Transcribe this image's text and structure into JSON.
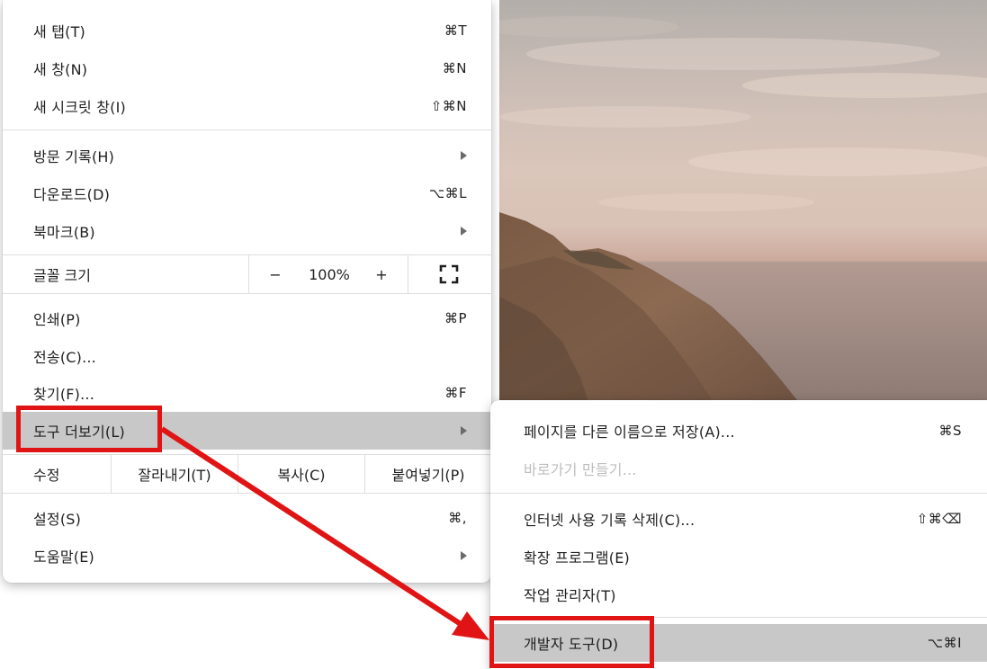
{
  "menu": {
    "new_tab": {
      "label": "새 탭(T)",
      "shortcut": "⌘T"
    },
    "new_window": {
      "label": "새 창(N)",
      "shortcut": "⌘N"
    },
    "new_incognito": {
      "label": "새 시크릿 창(I)",
      "shortcut": "⇧⌘N"
    },
    "history": {
      "label": "방문 기록(H)"
    },
    "downloads": {
      "label": "다운로드(D)",
      "shortcut": "⌥⌘L"
    },
    "bookmarks": {
      "label": "북마크(B)"
    },
    "zoom": {
      "label": "글꼴 크기",
      "minus": "−",
      "value": "100%",
      "plus": "+"
    },
    "print": {
      "label": "인쇄(P)",
      "shortcut": "⌘P"
    },
    "cast": {
      "label": "전송(C)..."
    },
    "find": {
      "label": "찾기(F)...",
      "shortcut": "⌘F"
    },
    "more_tools": {
      "label": "도구 더보기(L)"
    },
    "edit": {
      "label": "수정",
      "cut": "잘라내기(T)",
      "copy": "복사(C)",
      "paste": "붙여넣기(P)"
    },
    "settings": {
      "label": "설정(S)",
      "shortcut": "⌘,"
    },
    "help": {
      "label": "도움말(E)"
    }
  },
  "submenu": {
    "save_page": {
      "label": "페이지를 다른 이름으로 저장(A)...",
      "shortcut": "⌘S"
    },
    "create_shortcut": {
      "label": "바로가기 만들기..."
    },
    "clear_browsing": {
      "label": "인터넷 사용 기록 삭제(C)...",
      "shortcut": "⇧⌘⌫"
    },
    "extensions": {
      "label": "확장 프로그램(E)"
    },
    "task_manager": {
      "label": "작업 관리자(T)"
    },
    "developer_tools": {
      "label": "개발자 도구(D)",
      "shortcut": "⌥⌘I"
    }
  },
  "colors": {
    "highlight": "#c8c8c8",
    "annotation": "#e01414",
    "separator": "#dedede"
  }
}
